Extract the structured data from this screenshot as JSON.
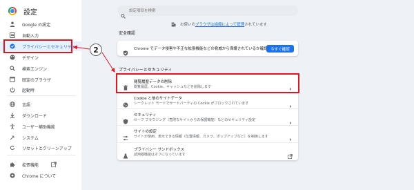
{
  "app": {
    "title": "設定"
  },
  "sidebar": {
    "items": [
      {
        "icon": "person-icon",
        "label": "Google の設定"
      },
      {
        "icon": "autofill-icon",
        "label": "自動入力"
      },
      {
        "icon": "shield-icon",
        "label": "プライバシーとセキュリティ"
      },
      {
        "icon": "palette-icon",
        "label": "デザイン"
      },
      {
        "icon": "search-icon",
        "label": "検索エンジン"
      },
      {
        "icon": "browser-icon",
        "label": "既定のブラウザ"
      },
      {
        "icon": "power-icon",
        "label": "起動時"
      },
      {
        "icon": "globe-icon",
        "label": "言語"
      },
      {
        "icon": "download-icon",
        "label": "ダウンロード"
      },
      {
        "icon": "accessibility-icon",
        "label": "ユーザー補助機能"
      },
      {
        "icon": "wrench-icon",
        "label": "システム"
      },
      {
        "icon": "reset-icon",
        "label": "リセットとクリーンアップ"
      },
      {
        "icon": "puzzle-icon",
        "label": "拡張機能"
      },
      {
        "icon": "chrome-icon",
        "label": "Chrome について"
      }
    ]
  },
  "search": {
    "placeholder": "設定項目を検索"
  },
  "managed_notice": {
    "before": "お使いの",
    "link": "ブラウザは組織によって管理",
    "after": "されています"
  },
  "safety_check": {
    "heading": "安全確認",
    "text": "Chrome でデータ侵害や不正な拡張機能などの脅威から保護されているか確認します",
    "button": "今すぐ確認"
  },
  "privacy": {
    "heading": "プライバシーとセキュリティ",
    "rows": [
      {
        "icon": "trash-icon",
        "title": "閲覧履歴データの削除",
        "subtitle": "閲覧履歴、Cookie、キャッシュなどを削除します"
      },
      {
        "icon": "cookie-icon",
        "title": "Cookie と他のサイトデータ",
        "subtitle": "シークレット モードでサードパーティの Cookie がブロックされています"
      },
      {
        "icon": "shield-icon",
        "title": "セキュリティ",
        "subtitle": "セーフ ブラウジング（危険なサイトからの保護機能）などのセキュリティ設定"
      },
      {
        "icon": "sliders-icon",
        "title": "サイトの設定",
        "subtitle": "サイトが使用、表示できる情報（位置情報、カメラ、ポップアップなど）を制御します"
      },
      {
        "icon": "flask-icon",
        "title": "プライバシー サンドボックス",
        "subtitle": "試用版機能はオフになっています"
      }
    ]
  },
  "annotation": {
    "step_number": "2",
    "highlight_color": "#e5141a"
  }
}
